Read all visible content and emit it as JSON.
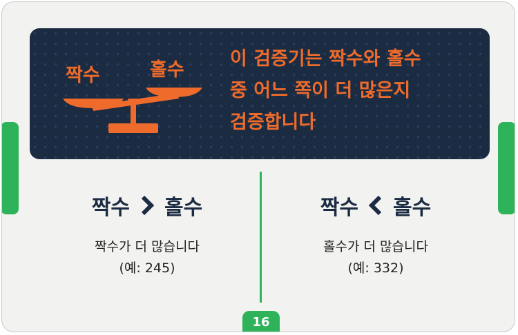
{
  "banner": {
    "scale_left_label": "짝수",
    "scale_right_label": "홀수",
    "lines": [
      "이 검증기는 짝수와 홀수",
      "중 어느 쪽이 더 많은지",
      "검증합니다"
    ]
  },
  "left_case": {
    "left_word": "짝수",
    "right_word": "홀수",
    "symbol": "greater-than",
    "description": "짝수가 더 많습니다",
    "example": "(예: 245)"
  },
  "right_case": {
    "left_word": "짝수",
    "right_word": "홀수",
    "symbol": "less-than",
    "description": "홀수가 더 많습니다",
    "example": "(예: 332)"
  },
  "page_number": "16",
  "colors": {
    "banner_bg": "#1b2b42",
    "accent_orange": "#ee6b2b",
    "accent_green": "#2fb35a",
    "text_navy": "#1b2b42"
  },
  "icons": [
    "balance-scale-icon",
    "chevron-right-icon",
    "chevron-left-icon"
  ]
}
